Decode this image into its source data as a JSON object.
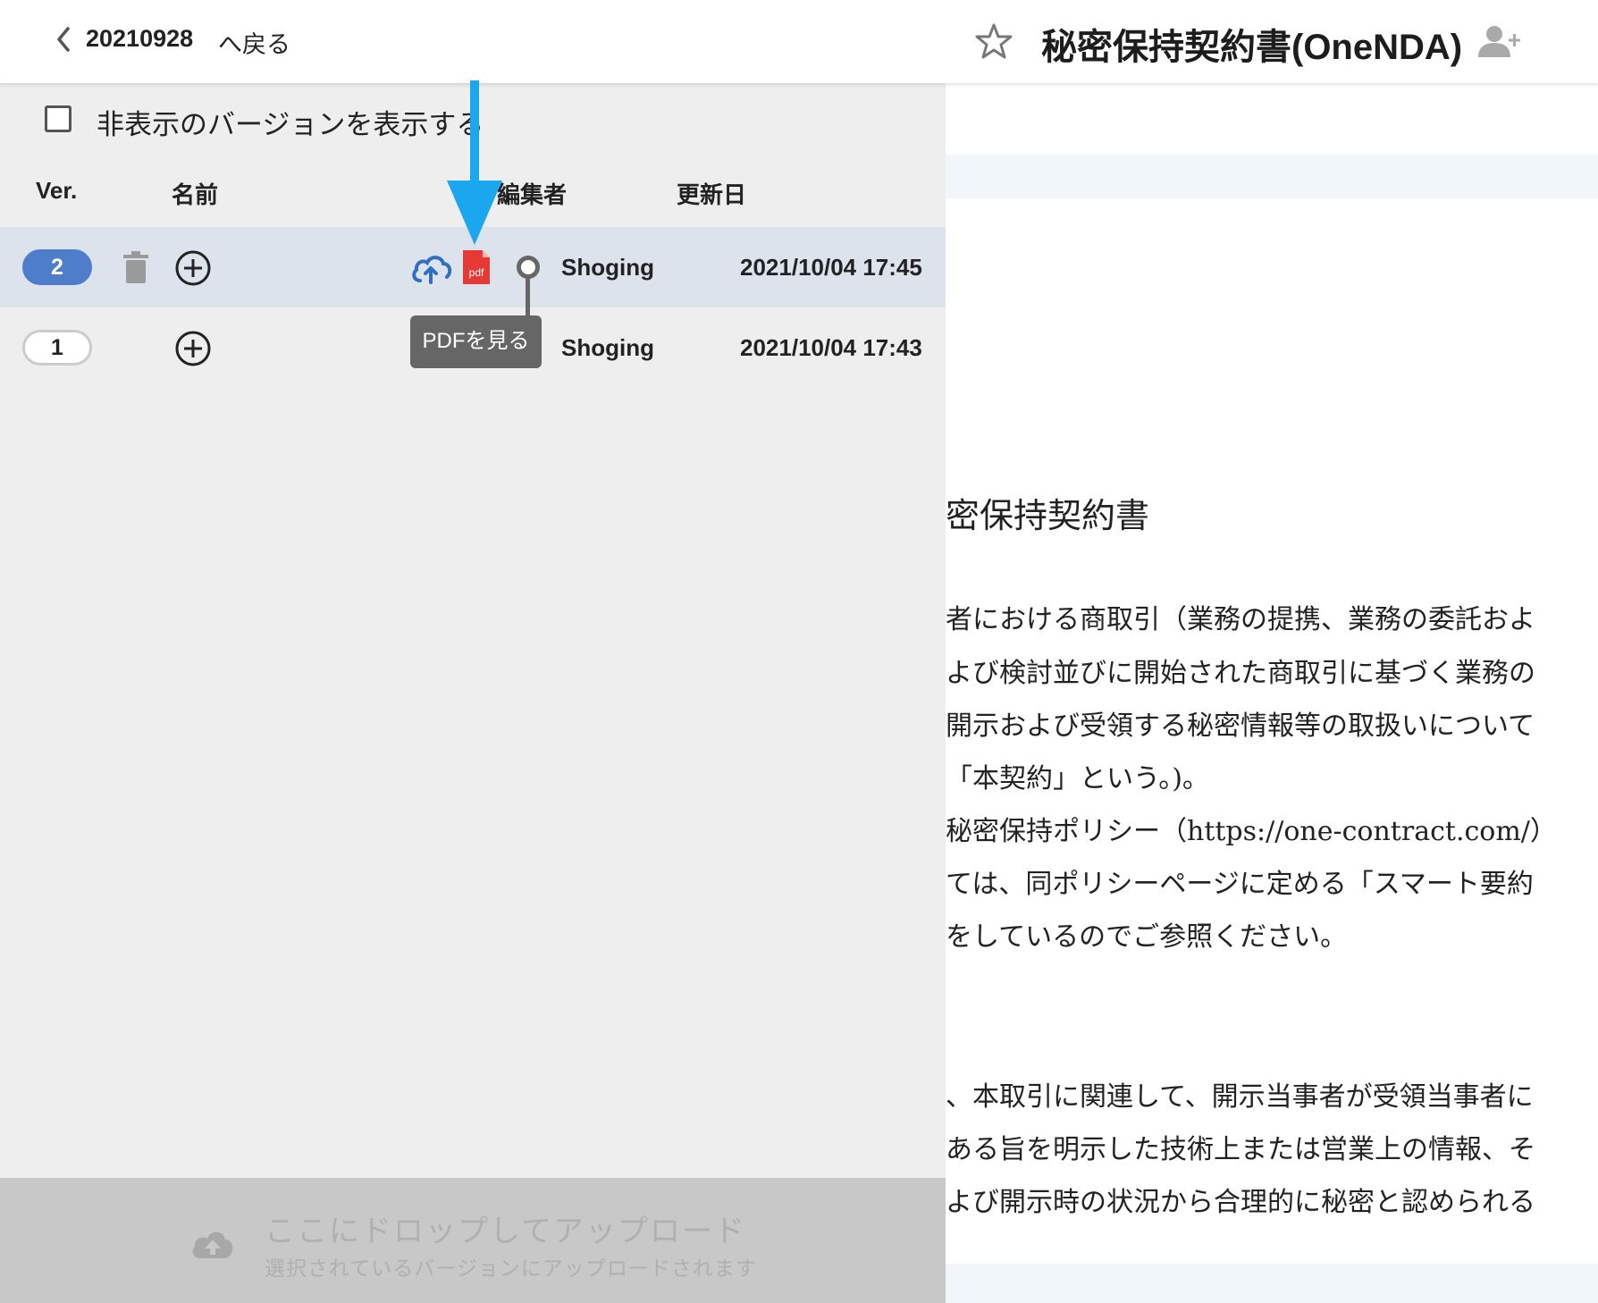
{
  "header": {
    "folder": "20210928",
    "back_label": "へ戻る",
    "title": "秘密保持契約書(OneNDA)"
  },
  "versions_panel": {
    "show_hidden_label": "非表示のバージョンを表示する",
    "columns": {
      "ver": "Ver.",
      "name": "名前",
      "editor": "編集者",
      "updated": "更新日"
    },
    "rows": [
      {
        "ver": "2",
        "editor": "Shoging",
        "updated": "2021/10/04 17:45",
        "selected": true
      },
      {
        "ver": "1",
        "editor": "Shoging",
        "updated": "2021/10/04 17:43",
        "selected": false
      }
    ],
    "tooltip": "PDFを見る",
    "pdf_icon_label": "pdf"
  },
  "dropzone": {
    "title": "ここにドロップしてアップロード",
    "subtitle": "選択されているバージョンにアップロードされます"
  },
  "document": {
    "heading": "密保持契約書",
    "lines": [
      "者における商取引（業務の提携、業務の委託およ",
      "よび検討並びに開始された商取引に基づく業務の",
      "開示および受領する秘密情報等の取扱いについて",
      "「本契約」という。)。",
      "秘密保持ポリシー（https://one-contract.com/）",
      "ては、同ポリシーページに定める「スマート要約",
      "をしているのでご参照ください。",
      "、本取引に関連して、開示当事者が受領当事者に",
      "ある旨を明示した技術上または営業上の情報、そ",
      "よび開示時の状況から合理的に秘密と認められる"
    ]
  },
  "colors": {
    "accent_blue": "#4e7dcb",
    "arrow_blue": "#1aa7f0",
    "pdf_red": "#e53935",
    "selected_row": "#dce3ec",
    "panel_bg": "#eeeeee"
  },
  "icons": [
    "chevron-left-icon",
    "star-icon",
    "add-person-icon",
    "trash-icon",
    "plus-circle-icon",
    "cloud-sync-icon",
    "pdf-file-icon",
    "cloud-upload-icon"
  ]
}
